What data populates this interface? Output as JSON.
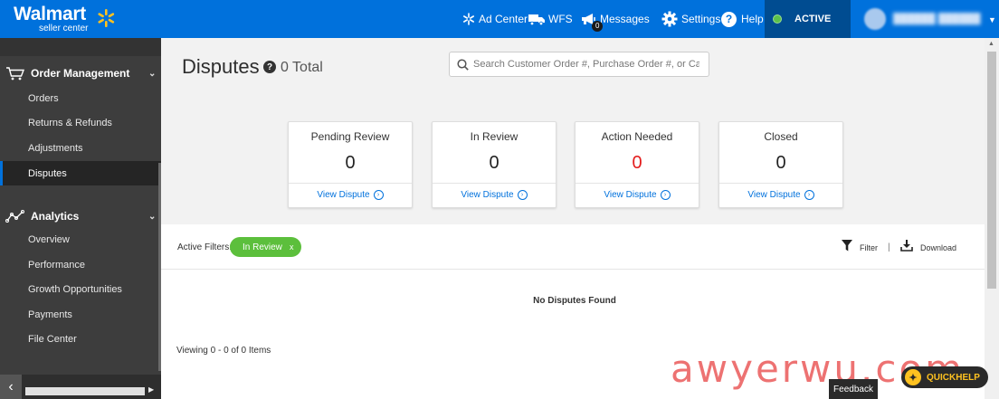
{
  "brand": {
    "name": "Walmart",
    "subtitle": "seller center"
  },
  "topnav": {
    "items": [
      {
        "label": "Ad Center",
        "icon": "ad-center-spark-icon"
      },
      {
        "label": "WFS",
        "icon": "truck-icon"
      },
      {
        "label": "Messages",
        "icon": "megaphone-icon",
        "badge": "0"
      },
      {
        "label": "Settings",
        "icon": "gear-icon"
      },
      {
        "label": "Help",
        "icon": "question-circle-icon"
      }
    ],
    "status": "ACTIVE",
    "status_color": "#5cc04b",
    "accent": "#0071dc"
  },
  "sidebar": {
    "sections": [
      {
        "label": "Order Management",
        "icon": "cart-icon",
        "items": [
          "Orders",
          "Returns & Refunds",
          "Adjustments",
          "Disputes"
        ],
        "active_item": "Disputes"
      },
      {
        "label": "Analytics",
        "icon": "line-chart-icon",
        "items": [
          "Overview",
          "Performance",
          "Growth Opportunities",
          "Payments",
          "File Center"
        ]
      }
    ]
  },
  "page": {
    "title": "Disputes",
    "total": "0 Total",
    "search_placeholder": "Search Customer Order #, Purchase Order #, or Case"
  },
  "cards": [
    {
      "title": "Pending Review",
      "count": "0",
      "link": "View Dispute"
    },
    {
      "title": "In Review",
      "count": "0",
      "link": "View Dispute"
    },
    {
      "title": "Action Needed",
      "count": "0",
      "link": "View Dispute",
      "count_color": "#e31c1c"
    },
    {
      "title": "Closed",
      "count": "0",
      "link": "View Dispute"
    }
  ],
  "filters": {
    "label": "Active Filters:",
    "chip_label": "In Review",
    "chip_remove": "x",
    "filter_label": "Filter",
    "separator": "|",
    "download_label": "Download"
  },
  "results": {
    "empty_message": "No Disputes Found",
    "viewing": "Viewing 0 - 0 of 0 Items"
  },
  "footer": {
    "feedback": "Feedback",
    "quickhelp": "QUICKHELP"
  },
  "watermark": "awyerwu.com"
}
